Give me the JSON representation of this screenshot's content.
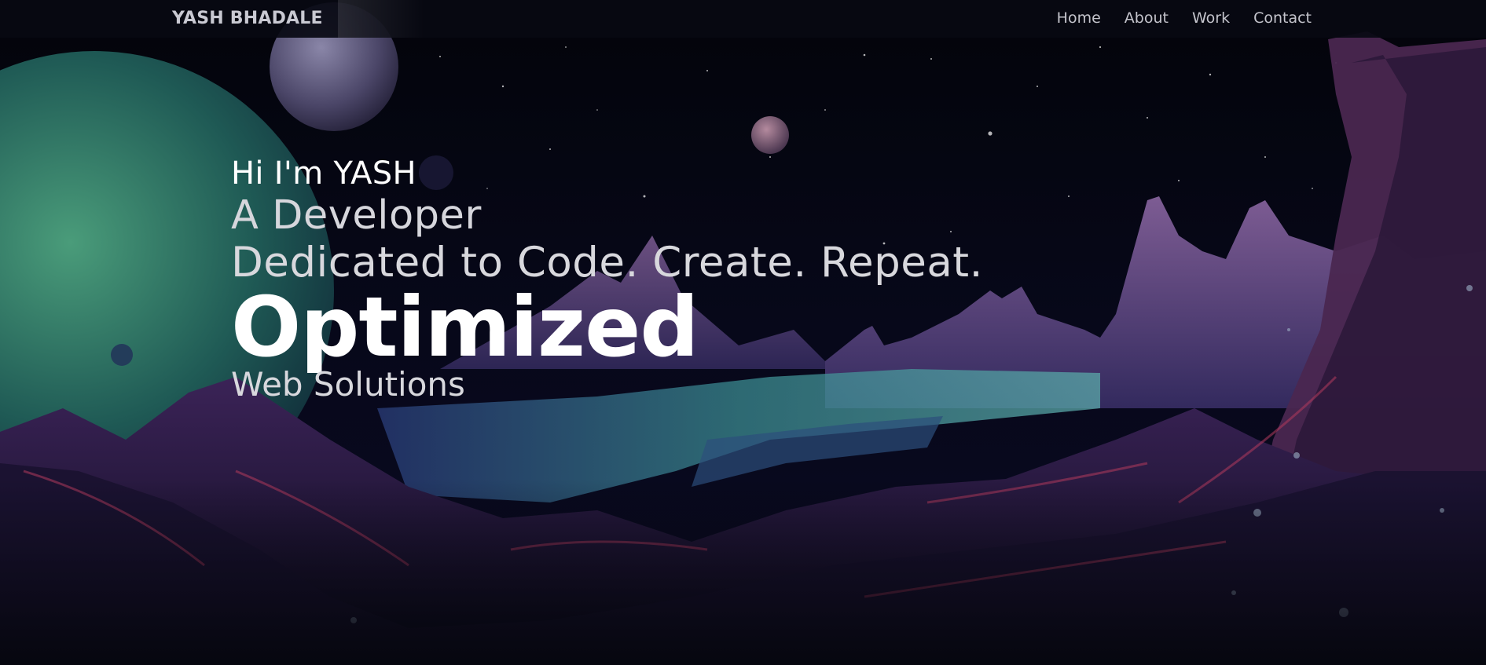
{
  "nav": {
    "brand": "YASH BHADALE",
    "links": [
      "Home",
      "About",
      "Work",
      "Contact"
    ]
  },
  "hero": {
    "greeting": "Hi I'm YASH",
    "role": "A Developer",
    "tagline": "Dedicated to Code. Create. Repeat.",
    "headline": "Optimized",
    "subheadline": "Web Solutions"
  },
  "colors": {
    "background": "#05060d",
    "navbar": "#080912",
    "text_primary": "#ffffff",
    "text_secondary": "#d6d6dc",
    "nav_text": "#c4c4cc"
  }
}
